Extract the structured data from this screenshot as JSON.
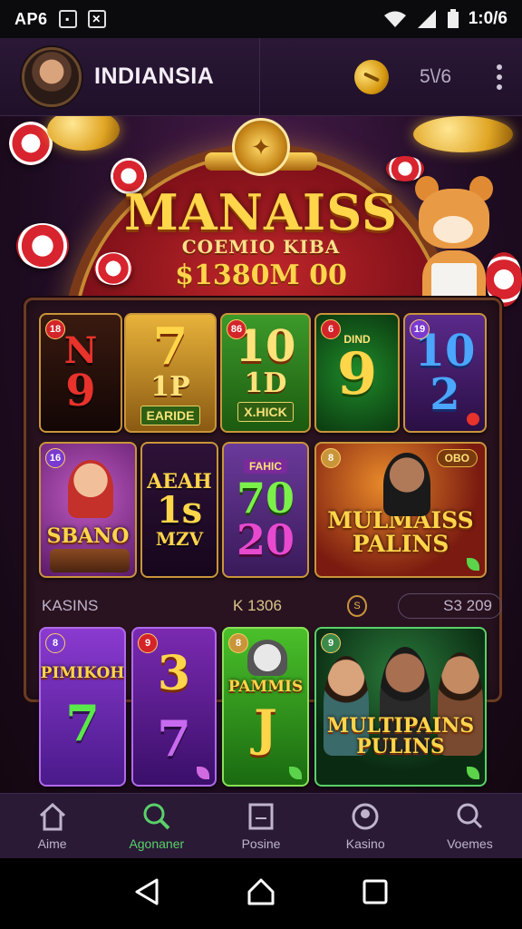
{
  "status_bar": {
    "carrier": "AP6",
    "time": "1:0/6",
    "icons": [
      "image-icon",
      "app-icon",
      "wifi-icon",
      "signal-icon",
      "battery-icon"
    ]
  },
  "header": {
    "title": "INDIANSIA",
    "balance": "5\\/6",
    "icons": [
      "avatar",
      "coin-icon",
      "more-icon"
    ]
  },
  "hero": {
    "title": "MANAISS",
    "subtitle": "COEMIO KIBA",
    "jackpot": "$1380M 00"
  },
  "games": {
    "row1": [
      {
        "badge": "18",
        "line1": "N",
        "line2": "9",
        "tag": ""
      },
      {
        "badge": "",
        "line1": "7",
        "line2": "1P",
        "tag": "EARIDE"
      },
      {
        "badge": "86",
        "line1": "10",
        "line2": "1D",
        "tag": "X.HICK"
      },
      {
        "badge": "6",
        "line1": "DIND",
        "line2": "9",
        "tag": ""
      },
      {
        "badge": "19",
        "line1": "10",
        "line2": "2",
        "tag": ""
      }
    ],
    "row2": [
      {
        "badge": "16",
        "title": "SBANO"
      },
      {
        "badge": "",
        "line1": "AEAH",
        "line2": "1s",
        "line3": "MZV"
      },
      {
        "badge": "",
        "header": "FAHIC",
        "line1": "70",
        "line2": "20"
      },
      {
        "badge": "8",
        "corner": "OBO",
        "title": "MULMAISS PALINS"
      }
    ],
    "row3": [
      {
        "badge": "8",
        "title": "PIMIKOH",
        "big": "7"
      },
      {
        "badge": "9",
        "big1": "3",
        "big2": "7"
      },
      {
        "badge": "8",
        "title": "PAMMIS",
        "big": "J"
      },
      {
        "badge": "9",
        "title": "MULTIPAINS PULINS"
      }
    ]
  },
  "info_strip": {
    "label": "KASINS",
    "jackpot": "K 1306",
    "coin_label": "S",
    "amount": "S3 209"
  },
  "bottom_nav": [
    {
      "label": "Aime",
      "icon": "home-icon",
      "active": false
    },
    {
      "label": "Agonaner",
      "icon": "search-icon",
      "active": true
    },
    {
      "label": "Posine",
      "icon": "document-icon",
      "active": false
    },
    {
      "label": "Kasino",
      "icon": "profile-icon",
      "active": false
    },
    {
      "label": "Voemes",
      "icon": "search-icon",
      "active": false
    }
  ],
  "colors": {
    "accent_green": "#5ad06a",
    "gold": "#ffd54a",
    "header_bg": "#2a1836",
    "nav_bg": "#2a1a36"
  }
}
